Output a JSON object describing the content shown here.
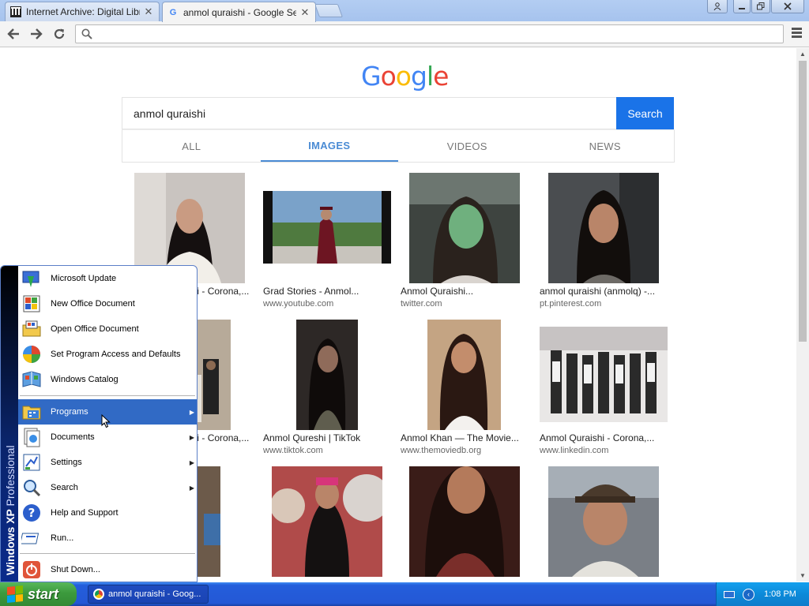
{
  "browser": {
    "tabs": [
      {
        "title": "Internet Archive: Digital Librar",
        "favicon": "archive-icon",
        "active": false
      },
      {
        "title": "anmol quraishi - Google Sear",
        "favicon": "google-icon",
        "active": true
      }
    ],
    "address": "",
    "menu_icon": "hamburger-menu-icon"
  },
  "google": {
    "logo": [
      "G",
      "o",
      "o",
      "g",
      "l",
      "e"
    ],
    "query": "anmol quraishi",
    "search_button": "Search",
    "tabs": [
      {
        "label": "ALL",
        "active": false
      },
      {
        "label": "IMAGES",
        "active": true
      },
      {
        "label": "VIDEOS",
        "active": false
      },
      {
        "label": "NEWS",
        "active": false
      }
    ]
  },
  "results": [
    {
      "caption": "Anmol Quraishi - Corona,...",
      "source": "",
      "color": "#c9c4c0"
    },
    {
      "caption": "Grad Stories - Anmol...",
      "source": "www.youtube.com",
      "color": "#5a7a4e"
    },
    {
      "caption": "Anmol Quraishi...",
      "source": "twitter.com",
      "color": "#56605a"
    },
    {
      "caption": "anmol quraishi (anmolq) -...",
      "source": "pt.pinterest.com",
      "color": "#4a4d50"
    },
    {
      "caption": "Anmol Quraishi - Corona,...",
      "source": "",
      "color": "#8a7e70"
    },
    {
      "caption": "Anmol Qureshi | TikTok",
      "source": "www.tiktok.com",
      "color": "#3a3431"
    },
    {
      "caption": "Anmol Khan — The Movie...",
      "source": "www.themoviedb.org",
      "color": "#c4a483"
    },
    {
      "caption": "Anmol Quraishi - Corona,...",
      "source": "www.linkedin.com",
      "color": "#c6c4c4"
    },
    {
      "caption": "",
      "source": "",
      "color": "#6c5a4a"
    },
    {
      "caption": "",
      "source": "",
      "color": "#b04b4a"
    },
    {
      "caption": "",
      "source": "",
      "color": "#7a2e2a"
    },
    {
      "caption": "",
      "source": "",
      "color": "#7a7f86"
    }
  ],
  "start_menu": {
    "banner_bold": "Windows XP",
    "banner_light": "Professional",
    "items": [
      {
        "label": "Microsoft Update",
        "icon": "windows-update-icon",
        "submenu": false
      },
      {
        "label": "New Office Document",
        "icon": "new-office-document-icon",
        "submenu": false
      },
      {
        "label": "Open Office Document",
        "icon": "open-office-document-icon",
        "submenu": false
      },
      {
        "label": "Set Program Access and Defaults",
        "icon": "program-defaults-icon",
        "submenu": false
      },
      {
        "label": "Windows Catalog",
        "icon": "windows-catalog-icon",
        "submenu": false
      },
      {
        "label": "Programs",
        "icon": "programs-folder-icon",
        "submenu": true
      },
      {
        "label": "Documents",
        "icon": "documents-icon",
        "submenu": true
      },
      {
        "label": "Settings",
        "icon": "settings-icon",
        "submenu": true
      },
      {
        "label": "Search",
        "icon": "search-icon",
        "submenu": true
      },
      {
        "label": "Help and Support",
        "icon": "help-icon",
        "submenu": false
      },
      {
        "label": "Run...",
        "icon": "run-icon",
        "submenu": false
      },
      {
        "label": "Shut Down...",
        "icon": "shutdown-icon",
        "submenu": false
      }
    ]
  },
  "taskbar": {
    "start_label": "start",
    "task_label": "anmol quraishi - Goog...",
    "clock": "1:08 PM"
  }
}
